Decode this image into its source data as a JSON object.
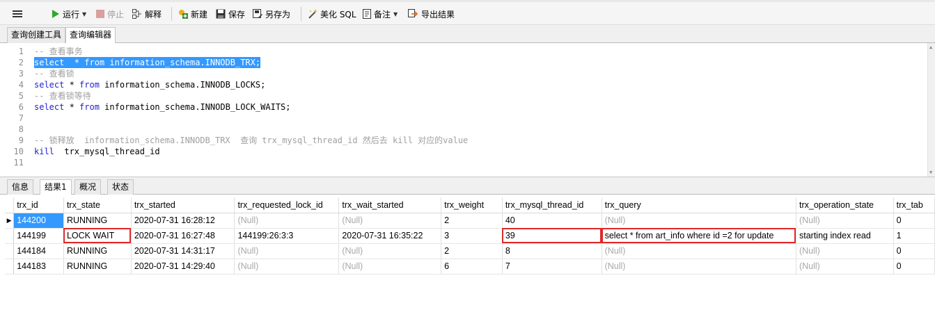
{
  "toolbar": {
    "menu_icon": "hamburger-menu-icon",
    "run": "运行",
    "stop": "停止",
    "explain": "解释",
    "new": "新建",
    "save": "保存",
    "save_as": "另存为",
    "beautify": "美化 SQL",
    "note": "备注",
    "export": "导出结果"
  },
  "top_tabs": [
    "查询创建工具",
    "查询编辑器"
  ],
  "editor": {
    "line_numbers": [
      "1",
      "2",
      "3",
      "4",
      "5",
      "6",
      "7",
      "8",
      "9",
      "10",
      "11"
    ],
    "lines": {
      "l1": "-- 查看事务",
      "l2": "select  * from information_schema.INNODB_TRX;",
      "l3": "-- 查看锁",
      "l4_kw1": "select",
      "l4_mid": " * ",
      "l4_kw2": "from",
      "l4_rest": " information_schema.INNODB_LOCKS;",
      "l5": "-- 查看锁等待",
      "l6_kw1": "select",
      "l6_mid": " * ",
      "l6_kw2": "from",
      "l6_rest": " information_schema.INNODB_LOCK_WAITS;",
      "l9": "-- 锁释放  information_schema.INNODB_TRX  查询 trx_mysql_thread_id 然后去 kill 对应的value",
      "l10_kw": "kill",
      "l10_rest": "  trx_mysql_thread_id"
    }
  },
  "result_tabs": [
    "信息",
    "结果1",
    "概况",
    "状态"
  ],
  "grid": {
    "columns": [
      "trx_id",
      "trx_state",
      "trx_started",
      "trx_requested_lock_id",
      "trx_wait_started",
      "trx_weight",
      "trx_mysql_thread_id",
      "trx_query",
      "trx_operation_state",
      "trx_tab"
    ],
    "rows": [
      [
        "144200",
        "RUNNING",
        "2020-07-31 16:28:12",
        "(Null)",
        "(Null)",
        "2",
        "40",
        "(Null)",
        "(Null)",
        "0"
      ],
      [
        "144199",
        "LOCK WAIT",
        "2020-07-31 16:27:48",
        "144199:26:3:3",
        "2020-07-31 16:35:22",
        "3",
        "39",
        "select * from art_info where id =2 for update",
        "starting index read",
        "1"
      ],
      [
        "144184",
        "RUNNING",
        "2020-07-31 14:31:17",
        "(Null)",
        "(Null)",
        "2",
        "8",
        "(Null)",
        "(Null)",
        "0"
      ],
      [
        "144183",
        "RUNNING",
        "2020-07-31 14:29:40",
        "(Null)",
        "(Null)",
        "6",
        "7",
        "(Null)",
        "(Null)",
        "0"
      ]
    ],
    "colors": {
      "selection": "#3399ff",
      "highlight_box": "#e02828",
      "null_text": "#a8a8a8"
    }
  }
}
